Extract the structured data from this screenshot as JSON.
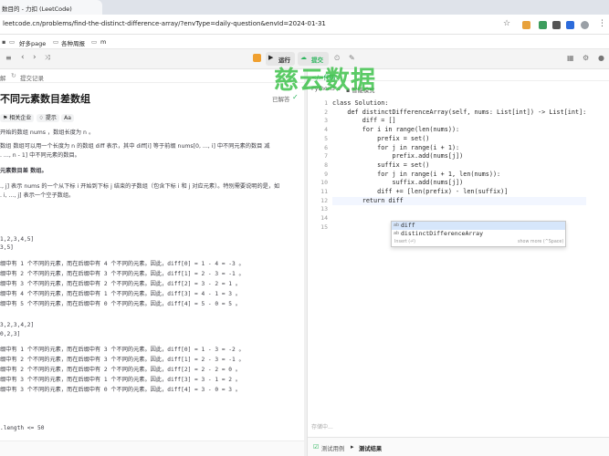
{
  "browser": {
    "tab_title": "数目的 - 力扣 (LeetCode)",
    "url": "leetcode.cn/problems/find-the-distinct-difference-array/?envType=daily-question&envId=2024-01-31",
    "bookmarks": [
      "好多page",
      "各种周报",
      "m"
    ]
  },
  "toolbar": {
    "run_label": "运行",
    "submit_label": "提交"
  },
  "left": {
    "tabs": [
      "解",
      "提交记录"
    ],
    "title": "不同元素数目差数组",
    "status": "已解答",
    "tags": [
      "相关企业",
      "提示",
      "Aa"
    ],
    "desc_lines": [
      "开始的数组 nums ，数组长度为 n 。",
      "数组 数组可以用一个长度为 n 的数组 diff 表示，其中 diff[i] 等于前缀 nums[0, ..., i] 中不同元素的数目 减",
      ". ..., n - 1] 中不同元素的数目。",
      "元素数目差 数组。",
      "., j] 表示 nums 的一个从下标 i 开始到下标 j 结束的子数组（包含下标 i 和 j 对应元素）。特别需要说明的是，如",
      ". i, ..., j] 表示一个空子数组。"
    ],
    "ex1_in": "1,2,3,4,5]",
    "ex1_out": "3,5]",
    "ex1_lines": [
      "缀中有 1 个不同的元素，而在后缀中有 4 个不同的元素。因此，diff[0] = 1 - 4 = -3 。",
      "缀中有 2 个不同的元素，而在后缀中有 3 个不同的元素。因此，diff[1] = 2 - 3 = -1 。",
      "缀中有 3 个不同的元素，而在后缀中有 2 个不同的元素。因此，diff[2] = 3 - 2 = 1 。",
      "缀中有 4 个不同的元素，而在后缀中有 1 个不同的元素。因此，diff[3] = 4 - 1 = 3 。",
      "缀中有 5 个不同的元素，而在后缀中有 0 个不同的元素。因此，diff[4] = 5 - 0 = 5 。"
    ],
    "ex2_in": "3,2,3,4,2]",
    "ex2_out": "0,2,3]",
    "ex2_lines": [
      "缀中有 1 个不同的元素，而在后缀中有 3 个不同的元素。因此，diff[0] = 1 - 3 = -2 。",
      "缀中有 2 个不同的元素，而在后缀中有 3 个不同的元素。因此，diff[1] = 2 - 3 = -1 。",
      "缀中有 2 个不同的元素，而在后缀中有 2 个不同的元素。因此，diff[2] = 2 - 2 = 0 。",
      "缀中有 3 个不同的元素，而在后缀中有 1 个不同的元素。因此，diff[3] = 3 - 1 = 2 。",
      "缀中有 3 个不同的元素，而在后缀中有 0 个不同的元素。因此，diff[4] = 3 - 0 = 3 。"
    ],
    "constraint": ".length <= 50"
  },
  "editor": {
    "tab": "</>代码",
    "language": "Python3",
    "mode": "智能模式",
    "lines": [
      "class Solution:",
      "    def distinctDifferenceArray(self, nums: List[int]) -> List[int]:",
      "        diff = []",
      "        for i in range(len(nums)):",
      "            prefix = set()",
      "            for j in range(i + 1):",
      "                prefix.add(nums[j])",
      "",
      "            suffix = set()",
      "            for j in range(i + 1, len(nums)):",
      "                suffix.add(nums[j])",
      "",
      "            diff += [len(prefix) - len(suffix)]",
      "",
      "        return diff"
    ],
    "line_numbers": [
      "1",
      "2",
      "3",
      "4",
      "5",
      "6",
      "7",
      "8",
      "9",
      "10",
      "11",
      "12",
      "13",
      "14",
      "15"
    ],
    "autocomplete": [
      "diff",
      "distinctDifferenceArray"
    ],
    "ac_footer_left": "Insert (⏎)",
    "ac_footer_right": "show more (^Space)",
    "saved": "存储中...",
    "bottom_tabs": [
      "测试用例",
      "测试结果"
    ]
  },
  "watermark": "慈云数据"
}
